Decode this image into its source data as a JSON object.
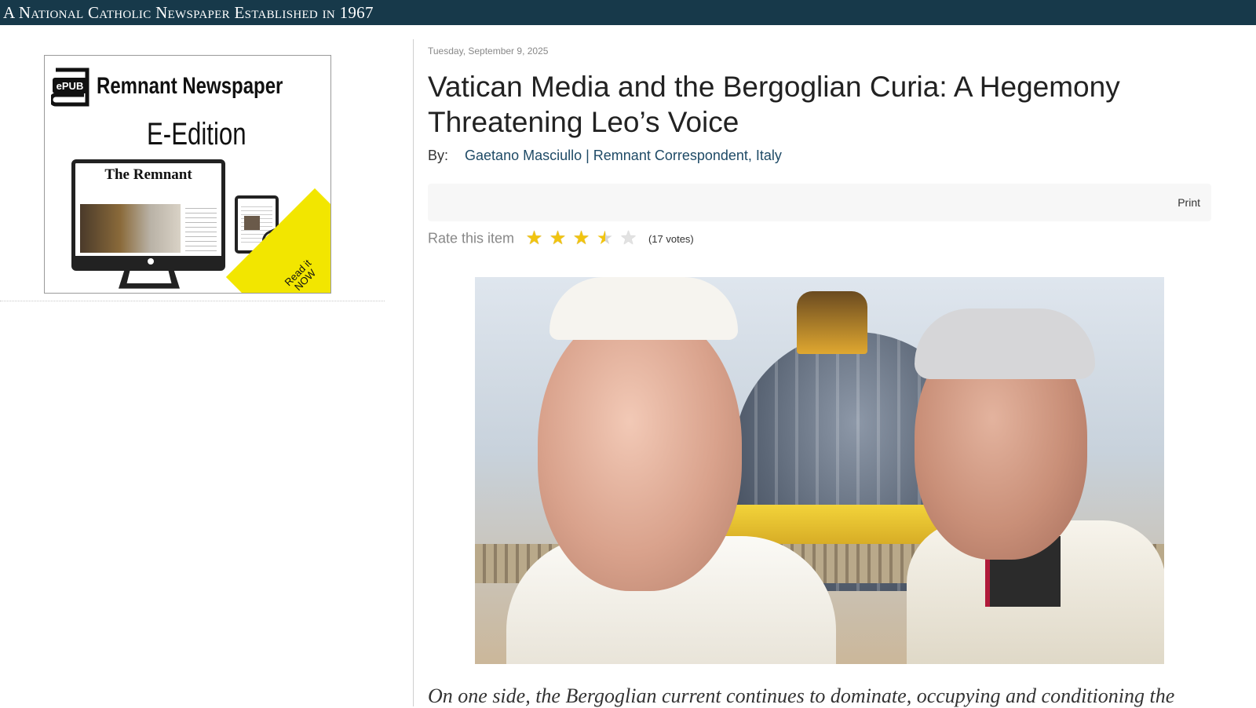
{
  "header": {
    "tagline": "A National Catholic Newspaper Established in 1967",
    "background_color": "#17394a"
  },
  "sidebar": {
    "ad": {
      "badge_label": "ePUB",
      "title": "Remnant Newspaper",
      "subtitle": "E-Edition",
      "masthead": "The Remnant",
      "ribbon_text": "Read it NOW",
      "ribbon_color": "#f2e600"
    }
  },
  "article": {
    "date": "Tuesday, September 9, 2025",
    "title": "Vatican Media and the Bergoglian Curia: A Hegemony Threatening Leo’s Voice",
    "byline_label": "By:",
    "author": "Gaetano Masciullo | Remnant Correspondent, Italy",
    "print_label": "Print",
    "rating": {
      "label": "Rate this item",
      "value": 3.5,
      "max": 5,
      "votes_text": "(17 votes)"
    },
    "hero_image_alt": "Pope Francis and Pope Leo in front of St. Peter's Basilica dome",
    "body_preview": "On one side, the Bergoglian current continues to dominate, occupying and conditioning the"
  },
  "colors": {
    "link": "#1e4a66",
    "star": "#f1c40f"
  }
}
